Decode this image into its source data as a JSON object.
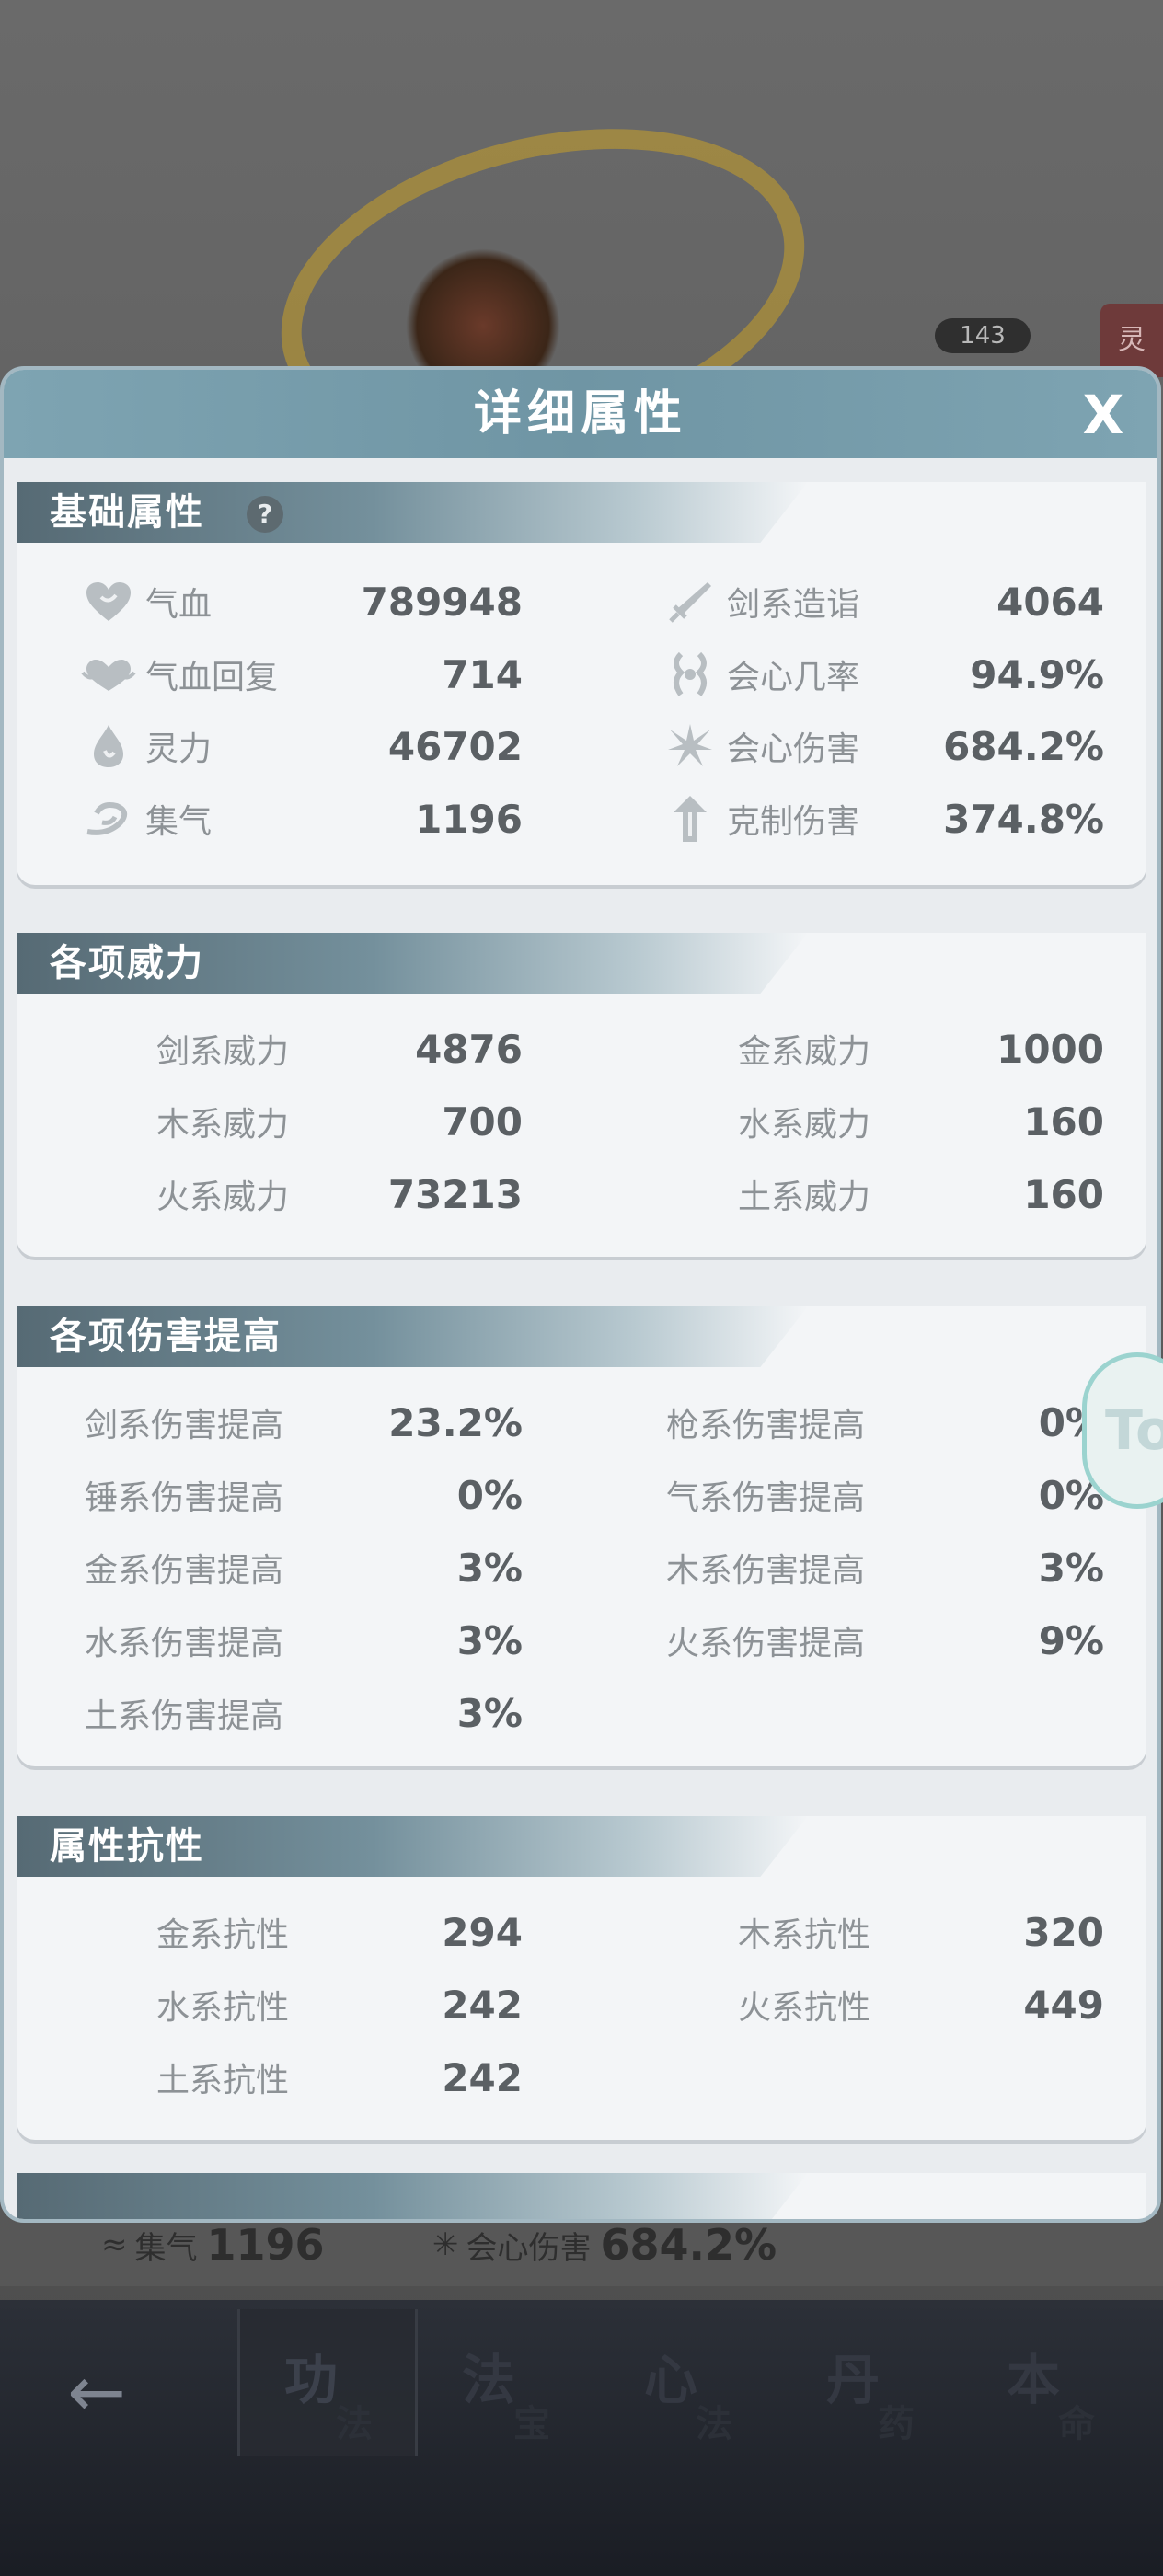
{
  "background": {
    "level_badge": "143",
    "side_tag": "灵",
    "under_row": {
      "left_label": "集气",
      "left_value": "1196",
      "right_label": "会心伤害",
      "right_value": "684.2%"
    }
  },
  "modal": {
    "title": "详细属性",
    "close_label": "X"
  },
  "sections": {
    "basic": {
      "title": "基础属性",
      "help_label": "?",
      "left": [
        {
          "label": "气血",
          "value": "789948",
          "icon": "heart-icon"
        },
        {
          "label": "气血回复",
          "value": "714",
          "icon": "heart-regen-icon"
        },
        {
          "label": "灵力",
          "value": "46702",
          "icon": "flame-drop-icon"
        },
        {
          "label": "集气",
          "value": "1196",
          "icon": "swirl-icon"
        }
      ],
      "right": [
        {
          "label": "剑系造诣",
          "value": "4064",
          "icon": "sword-icon"
        },
        {
          "label": "会心几率",
          "value": "94.9%",
          "icon": "crit-rate-icon"
        },
        {
          "label": "会心伤害",
          "value": "684.2%",
          "icon": "burst-icon"
        },
        {
          "label": "克制伤害",
          "value": "374.8%",
          "icon": "arrow-up-icon"
        }
      ]
    },
    "power": {
      "title": "各项威力",
      "left": [
        {
          "label": "剑系威力",
          "value": "4876"
        },
        {
          "label": "木系威力",
          "value": "700"
        },
        {
          "label": "火系威力",
          "value": "73213"
        }
      ],
      "right": [
        {
          "label": "金系威力",
          "value": "1000"
        },
        {
          "label": "水系威力",
          "value": "160"
        },
        {
          "label": "土系威力",
          "value": "160"
        }
      ]
    },
    "damage": {
      "title": "各项伤害提高",
      "left": [
        {
          "label": "剑系伤害提高",
          "value": "23.2%"
        },
        {
          "label": "锤系伤害提高",
          "value": "0%"
        },
        {
          "label": "金系伤害提高",
          "value": "3%"
        },
        {
          "label": "水系伤害提高",
          "value": "3%"
        },
        {
          "label": "土系伤害提高",
          "value": "3%"
        }
      ],
      "right": [
        {
          "label": "枪系伤害提高",
          "value": "0%"
        },
        {
          "label": "气系伤害提高",
          "value": "0%"
        },
        {
          "label": "木系伤害提高",
          "value": "3%"
        },
        {
          "label": "火系伤害提高",
          "value": "9%"
        }
      ]
    },
    "resist": {
      "title": "属性抗性",
      "left": [
        {
          "label": "金系抗性",
          "value": "294"
        },
        {
          "label": "水系抗性",
          "value": "242"
        },
        {
          "label": "土系抗性",
          "value": "242"
        }
      ],
      "right": [
        {
          "label": "木系抗性",
          "value": "320"
        },
        {
          "label": "火系抗性",
          "value": "449"
        }
      ]
    }
  },
  "floating_tab_label": "To",
  "bottom_nav": {
    "back_label": "←",
    "tabs": [
      {
        "main": "功",
        "sub": "法"
      },
      {
        "main": "法",
        "sub": "宝"
      },
      {
        "main": "心",
        "sub": "法"
      },
      {
        "main": "丹",
        "sub": "药"
      },
      {
        "main": "本",
        "sub": "命"
      }
    ]
  },
  "colors": {
    "modal_header": "#7ea4b2",
    "panel_bg": "#f3f5f7",
    "label": "#8d9296",
    "value": "#5b6064"
  }
}
